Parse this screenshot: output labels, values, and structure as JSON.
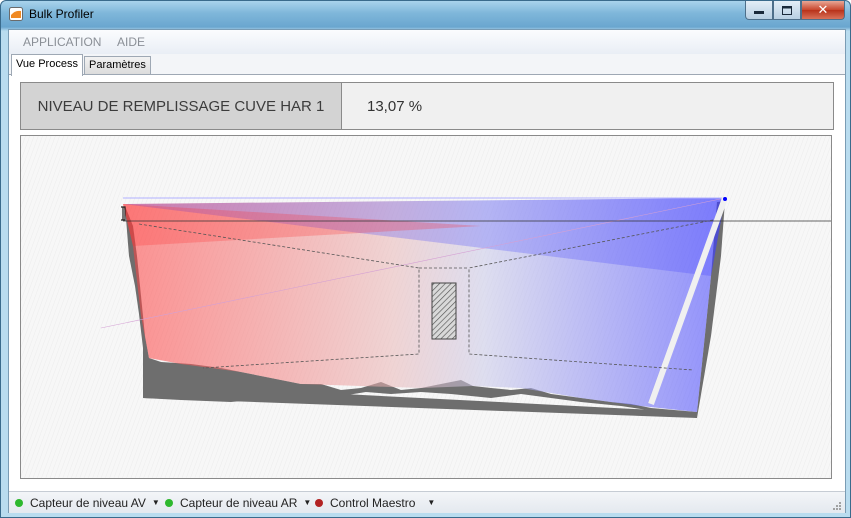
{
  "window": {
    "title": "Bulk Profiler",
    "minimize_glyph": "▁",
    "maximize_glyph": "▢",
    "close_glyph": "✕"
  },
  "menu": {
    "application": "APPLICATION",
    "help": "AIDE"
  },
  "tabs": [
    {
      "label": "Vue Process",
      "active": true
    },
    {
      "label": "Paramètres",
      "active": false
    }
  ],
  "level": {
    "label": "NIVEAU DE REMPLISSAGE CUVE HAR 1",
    "value": "13,07 %"
  },
  "status": {
    "sensors": [
      {
        "label": "Capteur de niveau AV",
        "state_color": "#2db82d"
      },
      {
        "label": "Capteur de niveau AR",
        "state_color": "#2db82d"
      },
      {
        "label": "Control Maestro",
        "state_color": "#b22222"
      }
    ]
  },
  "colors": {
    "sensor_left": "#ff0000",
    "sensor_right": "#0000ff",
    "tank_profile": "#6e6e6e"
  }
}
